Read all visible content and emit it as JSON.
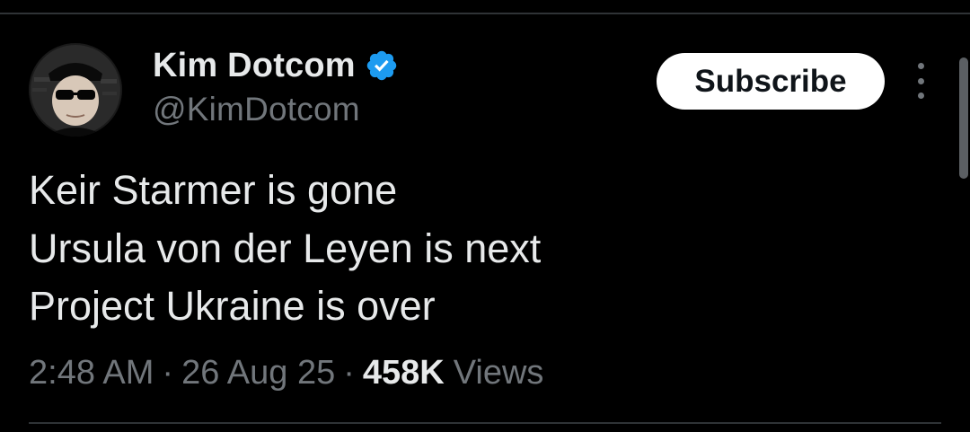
{
  "author": {
    "display_name": "Kim Dotcom",
    "handle": "@KimDotcom",
    "verified": true,
    "verified_color": "#1d9bf0",
    "avatar_icon": "avatar-photo"
  },
  "actions": {
    "subscribe_label": "Subscribe",
    "more_icon": "more-vertical-icon"
  },
  "tweet": {
    "lines": [
      "Keir Starmer is gone",
      "Ursula von der Leyen is next",
      "Project Ukraine is over"
    ]
  },
  "meta": {
    "time": "2:48 AM",
    "separator": "·",
    "date": "26 Aug 25",
    "views_count": "458K",
    "views_label": "Views"
  },
  "colors": {
    "background": "#000000",
    "text_primary": "#e7e9ea",
    "text_secondary": "#71767b",
    "button_bg": "#ffffff",
    "button_text": "#0f1419",
    "divider": "#2f3336"
  }
}
